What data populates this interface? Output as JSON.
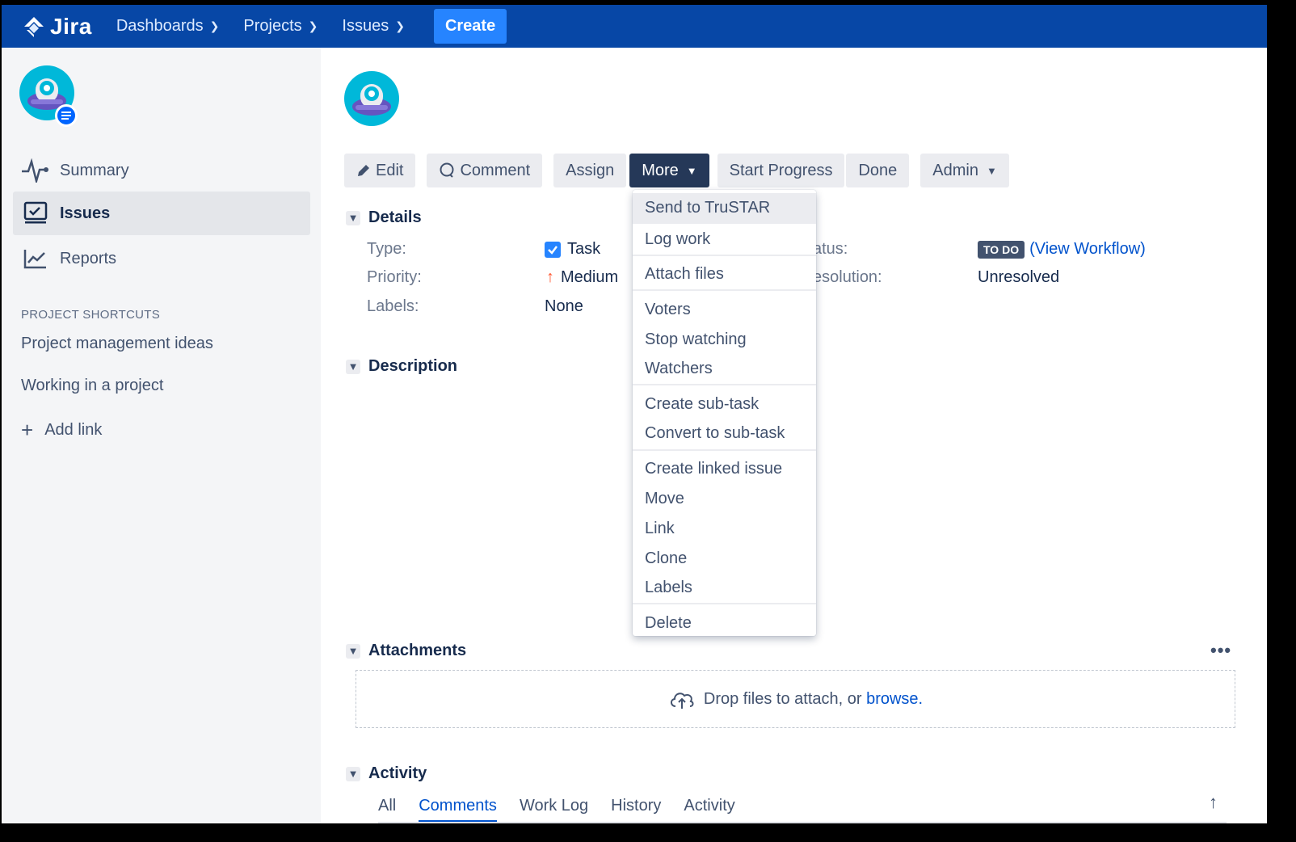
{
  "topnav": {
    "logo": "Jira",
    "items": [
      {
        "label": "Dashboards"
      },
      {
        "label": "Projects"
      },
      {
        "label": "Issues"
      }
    ],
    "create": "Create"
  },
  "sidebar": {
    "items": [
      {
        "label": "Summary"
      },
      {
        "label": "Issues"
      },
      {
        "label": "Reports"
      }
    ],
    "shortcuts_heading": "PROJECT SHORTCUTS",
    "shortcuts": [
      {
        "label": "Project management ideas"
      },
      {
        "label": "Working in a project"
      }
    ],
    "add_link": "Add link"
  },
  "toolbar": {
    "edit": "Edit",
    "comment": "Comment",
    "assign": "Assign",
    "more": "More",
    "start_progress": "Start Progress",
    "done": "Done",
    "admin": "Admin"
  },
  "details": {
    "heading": "Details",
    "type_label": "Type:",
    "type_value": "Task",
    "priority_label": "Priority:",
    "priority_value": "Medium",
    "labels_label": "Labels:",
    "labels_value": "None",
    "status_label": "atus:",
    "status_value": "TO DO",
    "view_workflow": "(View Workflow)",
    "resolution_label": "esolution:",
    "resolution_value": "Unresolved"
  },
  "description": {
    "heading": "Description"
  },
  "more_menu": {
    "items": [
      {
        "label": "Send to TruSTAR"
      },
      {
        "label": "Log work"
      },
      {
        "label": "Attach files"
      },
      {
        "label": "Voters"
      },
      {
        "label": "Stop watching"
      },
      {
        "label": "Watchers"
      },
      {
        "label": "Create sub-task"
      },
      {
        "label": "Convert to sub-task"
      },
      {
        "label": "Create linked issue"
      },
      {
        "label": "Move"
      },
      {
        "label": "Link"
      },
      {
        "label": "Clone"
      },
      {
        "label": "Labels"
      },
      {
        "label": "Delete"
      }
    ]
  },
  "attachments": {
    "heading": "Attachments",
    "more": "•••",
    "drop_text": "Drop files to attach, or ",
    "browse": "browse."
  },
  "activity": {
    "heading": "Activity",
    "tabs": [
      {
        "label": "All"
      },
      {
        "label": "Comments"
      },
      {
        "label": "Work Log"
      },
      {
        "label": "History"
      },
      {
        "label": "Activity"
      }
    ]
  },
  "colors": {
    "nav": "#0747a6",
    "accent": "#0052cc",
    "create": "#2684ff",
    "more_button": "#253858"
  }
}
